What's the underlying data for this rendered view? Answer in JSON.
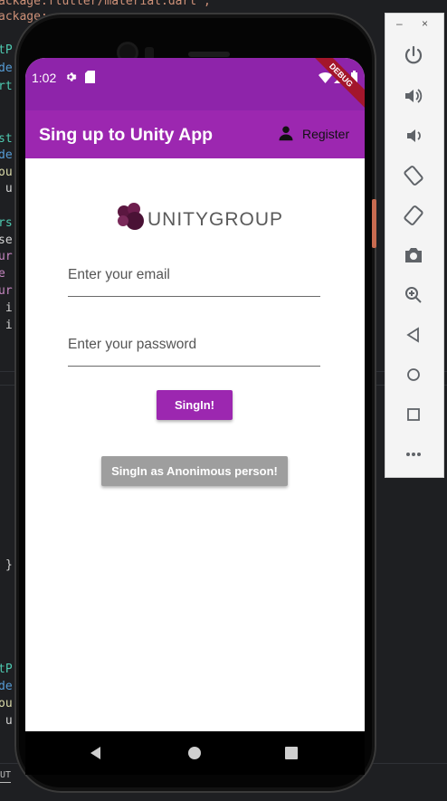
{
  "ide": {
    "code_lines": [
      {
        "text": "ackage:flutter/material.dart';",
        "color": "#ce9178"
      },
      {
        "text": "ackage:",
        "color": "#ce9178"
      },
      {
        "text": "tP",
        "color": "#4ec9b0"
      },
      {
        "text": "de",
        "color": "#569cd6"
      },
      {
        "text": "rt",
        "color": "#4ec9b0"
      },
      {
        "text": "st",
        "color": "#4ec9b0"
      },
      {
        "text": "de",
        "color": "#569cd6"
      },
      {
        "text": "ou",
        "color": "#dcdcaa"
      },
      {
        "text": " u",
        "color": "#d4d4d4"
      },
      {
        "text": "rs",
        "color": "#4ec9b0"
      },
      {
        "text": "se",
        "color": "#d4d4d4"
      },
      {
        "text": "ur",
        "color": "#c586c0"
      },
      {
        "text": "e",
        "color": "#c586c0"
      },
      {
        "text": "ur",
        "color": "#c586c0"
      },
      {
        "text": " i",
        "color": "#d4d4d4"
      },
      {
        "text": " i",
        "color": "#d4d4d4"
      },
      {
        "text": "}",
        "color": "#d4d4d4"
      },
      {
        "text": "tP",
        "color": "#4ec9b0"
      },
      {
        "text": "de",
        "color": "#569cd6"
      },
      {
        "text": "ou",
        "color": "#dcdcaa"
      },
      {
        "text": " u",
        "color": "#d4d4d4"
      }
    ],
    "output_tab": "UT"
  },
  "status_bar": {
    "time": "1:02",
    "debug_banner": "DEBUG",
    "icons": [
      "settings-icon",
      "sd-card-icon",
      "wifi-icon",
      "signal-icon",
      "battery-icon"
    ]
  },
  "app_bar": {
    "title": "Sing up to Unity App",
    "register_label": "Register",
    "register_icon": "person-icon",
    "color": "#9c27b0",
    "status_color": "#8e24aa"
  },
  "logo": {
    "text": "UNITYGROUP"
  },
  "form": {
    "email_placeholder": "Enter your email",
    "email_value": "",
    "password_placeholder": "Enter your password",
    "password_value": "",
    "signin_label": "SingIn!",
    "anon_label": "SingIn as Anonimous person!"
  },
  "nav_bar": {
    "buttons": [
      "back-icon",
      "home-icon",
      "recents-icon"
    ]
  },
  "emulator_toolbar": {
    "minimize": "–",
    "close": "×",
    "buttons": [
      "power-icon",
      "volume-up-icon",
      "volume-down-icon",
      "rotate-left-icon",
      "rotate-right-icon",
      "camera-icon",
      "zoom-icon",
      "back-icon",
      "home-icon",
      "overview-icon",
      "more-icon"
    ]
  }
}
